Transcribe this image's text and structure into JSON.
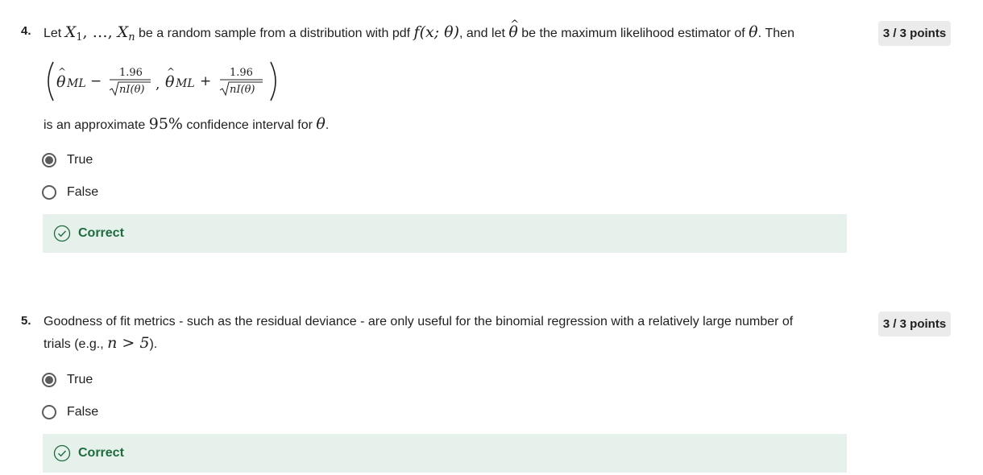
{
  "questions": [
    {
      "number": "4.",
      "points": "3 / 3 points",
      "text": {
        "let": "Let ",
        "x1": "X",
        "sub1": "1",
        "comma_dots": ", …, ",
        "xn": "X",
        "subn": "n",
        "mid": " be a random sample from a distribution with pdf ",
        "pdf": "f(x; θ)",
        "mid2": ", and let ",
        "theta_hat": "θ",
        "mid3": " be the maximum likelihood estimator of ",
        "theta": "θ",
        "end": ". Then",
        "after_formula_1": "is an approximate ",
        "pct": "95%",
        "after_formula_2": " confidence interval for ",
        "theta2": "θ",
        "period": "."
      },
      "formula": {
        "theta": "θ",
        "subscript": "ML",
        "minus": "−",
        "plus": "+",
        "numerator": "1.96",
        "denominator": "nI(θ)",
        "separator": ","
      },
      "options": [
        {
          "label": "True",
          "selected": true
        },
        {
          "label": "False",
          "selected": false
        }
      ],
      "feedback": "Correct"
    },
    {
      "number": "5.",
      "points": "3 / 3 points",
      "text": {
        "line1": "Goodness of fit metrics - such as the residual deviance -  are only useful for the binomial regression with a relatively large number of",
        "line2_a": "trials (e.g., ",
        "math": "n > 5",
        "line2_b": ")."
      },
      "options": [
        {
          "label": "True",
          "selected": true
        },
        {
          "label": "False",
          "selected": false
        }
      ],
      "feedback": "Correct"
    }
  ],
  "colors": {
    "feedback_bg": "#e6f1ec",
    "feedback_text": "#1e6b3e",
    "points_bg": "#ebebeb",
    "radio": "#5b5b5b"
  },
  "icons": {
    "feedback": "check-circle-icon",
    "selected_radio": "radio-selected-icon",
    "unselected_radio": "radio-unselected-icon"
  }
}
